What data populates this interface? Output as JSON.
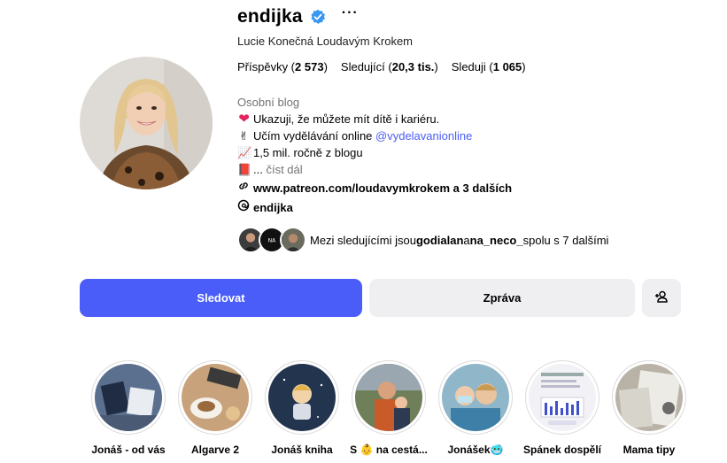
{
  "profile": {
    "username": "endijka",
    "more_label": "···",
    "full_name": "Lucie Konečná Loudavým Krokem",
    "stats": [
      {
        "label_before": "Příspěvky (",
        "value": "2 573",
        "label_after": ")"
      },
      {
        "label_before": "Sledující (",
        "value": "20,3 tis.",
        "label_after": ")"
      },
      {
        "label_before": "Sleduji (",
        "value": "1 065",
        "label_after": ")"
      }
    ],
    "category": "Osobní blog",
    "bio_lines": [
      {
        "icon": "❤",
        "text": "Ukazuji, že můžete mít dítě i kariéru."
      },
      {
        "icon": "✌",
        "text": "Učím vydělávání online ",
        "mention": "@vydelavanionline"
      },
      {
        "icon": "📈",
        "text": "1,5 mil. ročně z blogu"
      },
      {
        "icon": "📕",
        "text": "... ",
        "more": "číst dál"
      }
    ],
    "link_text": "www.patreon.com/loudavymkrokem a 3 dalších",
    "threads_handle": "endijka",
    "followed_by": {
      "prefix": "Mezi sledujícími jsou ",
      "user1": "godialan",
      "middle": " a ",
      "user2": "na_neco_",
      "suffix": " spolu s 7 dalšími"
    }
  },
  "actions": {
    "follow_label": "Sledovat",
    "message_label": "Zpráva",
    "add_user_icon": "person-add-icon"
  },
  "highlights": [
    {
      "label": "Jonáš - od vás",
      "bg": "#5b6f8f"
    },
    {
      "label": "Algarve 2",
      "bg": "#c8a27a"
    },
    {
      "label": "Jonáš kniha",
      "bg": "#23344f"
    },
    {
      "label": "S 👶 na cestá...",
      "bg": "#7f6b4c"
    },
    {
      "label": "Jonášek🥶",
      "bg": "#8fb6c9"
    },
    {
      "label": "Spánek dospělí",
      "bg": "#f2f2f6"
    },
    {
      "label": "Mama tipy",
      "bg": "#b9b2a6"
    }
  ],
  "colors": {
    "accent": "#4a5df9",
    "secondary_button": "#efeff2",
    "muted_text": "#737373"
  }
}
